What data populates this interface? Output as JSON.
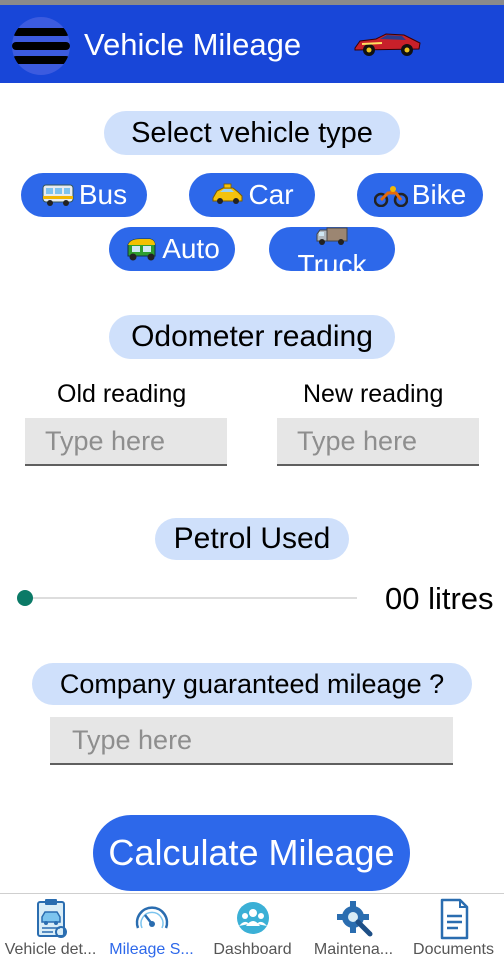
{
  "app_bar": {
    "title": "Vehicle Mileage",
    "menu_icon": "hamburger-menu-icon",
    "logo_icon": "race-car-icon",
    "background": "#1846d8"
  },
  "vehicle_section": {
    "heading": "Select vehicle type",
    "types": [
      {
        "label": "Bus",
        "icon": "bus-icon"
      },
      {
        "label": "Car",
        "icon": "car-icon"
      },
      {
        "label": "Bike",
        "icon": "bike-icon"
      },
      {
        "label": "Auto",
        "icon": "auto-rickshaw-icon"
      },
      {
        "label": "Truck",
        "icon": "truck-icon"
      }
    ]
  },
  "odometer_section": {
    "heading": "Odometer reading",
    "old_label": "Old reading",
    "new_label": "New reading",
    "old_placeholder": "Type here",
    "new_placeholder": "Type here"
  },
  "petrol_section": {
    "heading": "Petrol Used",
    "slider_value": 0,
    "value_text": "00 litres"
  },
  "guarantee_section": {
    "heading": "Company guaranteed mileage ?",
    "placeholder": "Type here"
  },
  "calculate_label": "Calculate Mileage",
  "bottom_nav": {
    "items": [
      {
        "label": "Vehicle det...",
        "icon": "vehicle-details-icon",
        "active": false
      },
      {
        "label": "Mileage S...",
        "icon": "speedometer-icon",
        "active": true
      },
      {
        "label": "Dashboard",
        "icon": "group-icon",
        "active": false
      },
      {
        "label": "Maintena...",
        "icon": "maintenance-icon",
        "active": false
      },
      {
        "label": "Documents",
        "icon": "document-icon",
        "active": false
      }
    ]
  },
  "colors": {
    "accent": "#2d68ea",
    "pill": "#cfe0fb",
    "slider_thumb": "#0b7a67"
  }
}
